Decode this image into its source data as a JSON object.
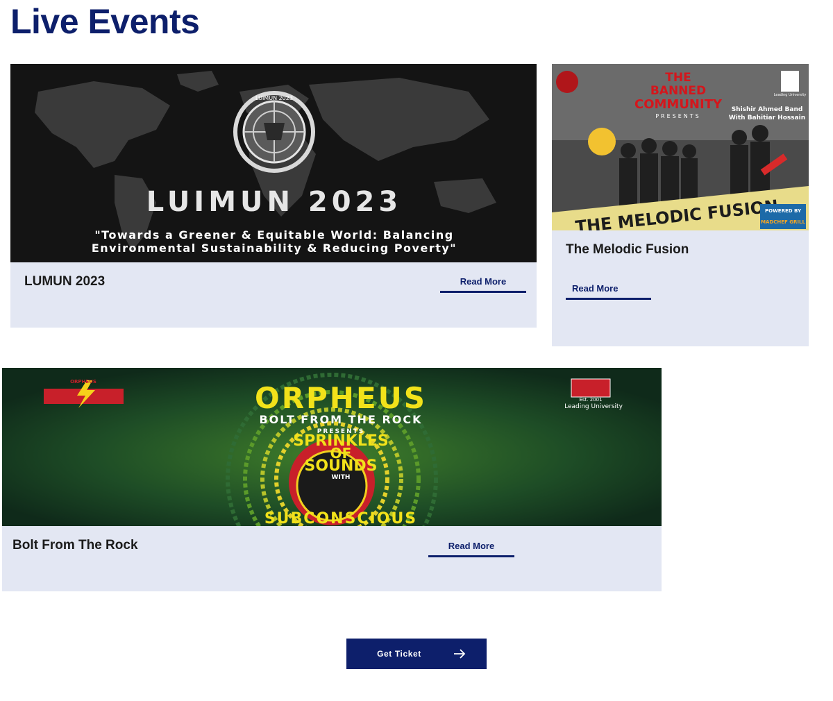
{
  "page": {
    "title": "Live Events"
  },
  "events": [
    {
      "title": "LUMUN  2023",
      "read_more": "Read More",
      "banner": {
        "headline": "LUIMUN 2023",
        "emblem_text": "LUIMUN 2023",
        "tagline_line1": "\"Towards a Greener & Equitable World: Balancing",
        "tagline_line2": "Environmental Sustainability & Reducing Poverty\""
      }
    },
    {
      "title": "The Melodic Fusion",
      "read_more": "Read More",
      "banner": {
        "org_line1": "THE",
        "org_line2": "BANNED",
        "org_line3": "COMMUNITY",
        "presents": "PRESENTS",
        "artist_line1": "Shishir Ahmed Band",
        "artist_line2": "With Bahitiar Hossain",
        "headline": "THE MELODIC FUSION",
        "powered": "POWERED BY",
        "sponsor": "MADCHEF GRILL",
        "university": "Leading University"
      }
    },
    {
      "title": "Bolt From The Rock",
      "read_more": "Read More",
      "banner": {
        "band_logo": "ORPHEUS",
        "headline": "ORPHEUS",
        "subheadline": "BOLT FROM THE ROCK",
        "presents": "PRESENTS",
        "line1": "SPRINKLES",
        "line2": "OF",
        "line3": "SOUNDS",
        "with": "WITH",
        "act": "SUBCONSCIOUS",
        "est": "Est. 2001",
        "university": "Leading University"
      }
    }
  ],
  "cta": {
    "label": "Get Ticket",
    "icon": "arrow-right-icon"
  },
  "colors": {
    "brand": "#0d1f6b",
    "card_bg": "#e3e7f3"
  }
}
